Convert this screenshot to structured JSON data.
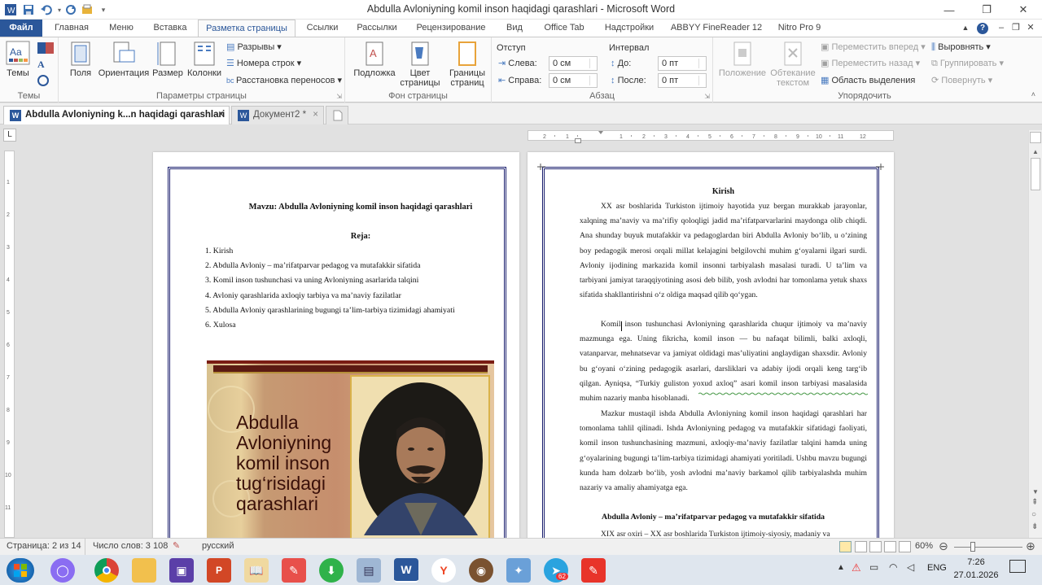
{
  "window": {
    "title": "Abdulla Avloniyning komil inson haqidagi qarashlari  -  Microsoft Word",
    "help": "?"
  },
  "ribbon_tabs": [
    "Файл",
    "Главная",
    "Меню",
    "Вставка",
    "Разметка страницы",
    "Ссылки",
    "Рассылки",
    "Рецензирование",
    "Вид",
    "Office Tab",
    "Надстройки",
    "ABBYY FineReader 12",
    "Nitro Pro 9"
  ],
  "ribbon": {
    "themes": {
      "label": "Темы",
      "group": "Темы"
    },
    "page_setup": {
      "margins": "Поля",
      "orientation": "Ориентация",
      "size": "Размер",
      "columns": "Колонки",
      "breaks": "Разрывы",
      "line_numbers": "Номера строк",
      "hyphenation": "Расстановка переносов",
      "group": "Параметры страницы"
    },
    "page_bg": {
      "watermark": "Подложка",
      "page_color_1": "Цвет",
      "page_color_2": "страницы",
      "borders_1": "Границы",
      "borders_2": "страниц",
      "group": "Фон страницы"
    },
    "paragraph": {
      "indent": "Отступ",
      "left": "Слева:",
      "right": "Справа:",
      "left_val": "0 см",
      "right_val": "0 см",
      "spacing": "Интервал",
      "before": "До:",
      "after": "После:",
      "before_val": "0 пт",
      "after_val": "0 пт",
      "group": "Абзац"
    },
    "arrange": {
      "position_1": "Положение",
      "wrap_1": "Обтекание",
      "wrap_2": "текстом",
      "forward": "Переместить вперед",
      "backward": "Переместить назад",
      "selection": "Область выделения",
      "align": "Выровнять",
      "group_btn": "Группировать",
      "rotate": "Повернуть",
      "group": "Упорядочить"
    }
  },
  "doc_tabs": [
    {
      "label": "Abdulla Avloniyning k...n haqidagi qarashlari",
      "close": "×"
    },
    {
      "label": "Документ2 *",
      "close": "×"
    }
  ],
  "page1": {
    "topic": "Mavzu: Abdulla Avloniyning komil inson haqidagi qarashlari",
    "plan_title": "Reja:",
    "plan": [
      "1.  Kirish",
      "2.  Abdulla Avloniy – ma’rifatparvar pedagog va mutafakkir sifatida",
      "3.  Komil inson tushunchasi va uning Avloniyning asarlarida talqini",
      "4.  Avloniy qarashlarida axloqiy tarbiya va ma’naviy fazilatlar",
      "5.  Abdulla Avloniy qarashlarining bugungi ta’lim-tarbiya tizimidagi ahamiyati",
      "6.  Xulosa"
    ],
    "cover_lines": [
      "Abdulla",
      "Avloniyning",
      "komil inson",
      "tug‘risidagi",
      "qarashlari"
    ]
  },
  "page2": {
    "heading": "Kirish",
    "p1": "XX asr boshlarida Turkiston ijtimoiy hayotida yuz bergan murakkab jarayonlar, xalqning ma’naviy va ma’rifiy qoloqligi jadid ma’rifatparvarlarini maydonga olib chiqdi. Ana shunday buyuk mutafakkir va pedagoglardan biri Abdulla Avloniy bo‘lib, u o‘zining boy pedagogik merosi orqali millat kelajagini belgilovchi muhim g‘oyalarni ilgari surdi. Avloniy ijodining markazida komil insonni tarbiyalash masalasi turadi. U ta’lim va tarbiyani jamiyat taraqqiyotining asosi deb bilib, yosh avlodni har tomonlama yetuk shaxs sifatida shakllantirishni o‘z oldiga maqsad qilib qo‘ygan.",
    "p2": "Komil inson tushunchasi Avloniyning qarashlarida chuqur ijtimoiy va ma’naviy mazmunga ega. Uning fikricha, komil inson — bu nafaqat bilimli, balki axloqli, vatanparvar, mehnatsevar va jamiyat oldidagi mas’uliyatini anglaydigan shaxsdir. Avloniy bu g‘oyani o‘zining pedagogik asarlari, darsliklari va adabiy ijodi orqali keng targ‘ib qilgan. Ayniqsa, “Turkiy guliston yoxud axloq” asari komil inson tarbiyasi masalasida muhim nazariy manba hisoblanadi.",
    "p3": "Mazkur mustaqil ishda Abdulla Avloniyning komil inson haqidagi qarashlari har tomonlama tahlil qilinadi. Ishda Avloniyning pedagog va mutafakkir sifatidagi faoliyati, komil inson tushunchasining mazmuni, axloqiy-ma’naviy fazilatlar talqini hamda uning g‘oyalarining bugungi ta’lim-tarbiya tizimidagi ahamiyati yoritiladi. Ushbu mavzu bugungi kunda ham dolzarb bo‘lib, yosh avlodni ma’naviy barkamol qilib tarbiyalashda muhim nazariy va amaliy ahamiyatga ega.",
    "heading2": "Abdulla Avloniy – ma’rifatparvar pedagog va mutafakkir sifatida",
    "p4": "XIX asr oxiri – XX asr boshlarida Turkiston ijtimoiy-siyosiy, madaniy va"
  },
  "status": {
    "page": "Страница: 2 из 14",
    "words": "Число слов: 3 108",
    "lang": "русский",
    "zoom": "60%"
  },
  "taskbar": {
    "lang": "ENG",
    "time": "7:26",
    "date": "27.01.2026",
    "badge": "62"
  },
  "colors": {
    "word_blue": "#2b579a",
    "page_border": "#1b1f6e"
  }
}
